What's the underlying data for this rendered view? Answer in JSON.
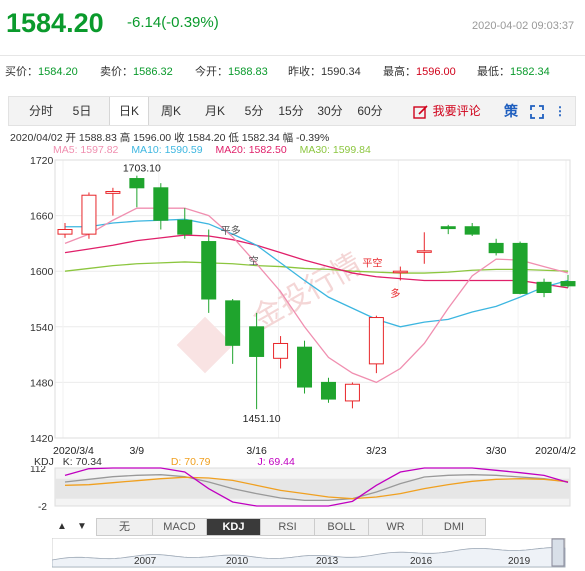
{
  "header": {
    "price": "1584.20",
    "change": "-6.14(-0.39%)",
    "datetime": "2020-04-02 09:03:37"
  },
  "quote": [
    {
      "label": "买价：",
      "value": "1584.20",
      "color": "green"
    },
    {
      "label": "卖价：",
      "value": "1586.32",
      "color": "green"
    },
    {
      "label": "今开：",
      "value": "1588.83",
      "color": "green"
    },
    {
      "label": "昨收：",
      "value": "1590.34",
      "color": "normal"
    },
    {
      "label": "最高：",
      "value": "1596.00",
      "color": "red"
    },
    {
      "label": "最低：",
      "value": "1582.34",
      "color": "green"
    }
  ],
  "tabs": [
    "分时",
    "5日",
    "日K",
    "周K",
    "月K",
    "5分",
    "15分",
    "30分",
    "60分"
  ],
  "selected_tab": "日K",
  "review_label": "我要评论",
  "ce_label": "策",
  "info_line": "2020/04/02  开 1588.83  高 1596.00  收 1584.20  低 1582.34  幅 -0.39%",
  "ma_legend": [
    {
      "label": "MA5: 1597.82",
      "color": "#f08fb0"
    },
    {
      "label": "MA10: 1590.59",
      "color": "#3cb6e0"
    },
    {
      "label": "MA20: 1582.50",
      "color": "#e0206a"
    },
    {
      "label": "MA30: 1599.84",
      "color": "#8cc63f"
    }
  ],
  "annotations": {
    "high": "1703.10",
    "low": "1451.10",
    "ping_duo": "平多",
    "kong": "空",
    "ping_kong": "平空",
    "duo": "多"
  },
  "watermark": "金投行情",
  "kdj": {
    "name": "KDJ",
    "k": "K: 70.34",
    "d": "D: 70.79",
    "j": "J: 69.44",
    "ticks": [
      "112",
      "-2"
    ]
  },
  "indicator_tabs": [
    "无",
    "MACD",
    "KDJ",
    "RSI",
    "BOLL",
    "WR",
    "DMI"
  ],
  "selected_indicator": "KDJ",
  "arrows": [
    "▲",
    "▼"
  ],
  "overview_years": [
    "2007",
    "2010",
    "2013",
    "2016",
    "2019"
  ],
  "chart_data": {
    "type": "candlestick",
    "y_ticks": [
      1720,
      1660,
      1600,
      1540,
      1480,
      1420
    ],
    "ylim": [
      1420,
      1720
    ],
    "x_labels": [
      "2020/3/4",
      "3/9",
      "3/16",
      "3/23",
      "3/30",
      "2020/4/2"
    ],
    "candles": [
      {
        "o": 1640,
        "h": 1652,
        "c": 1645,
        "l": 1636
      },
      {
        "o": 1640,
        "h": 1685,
        "c": 1682,
        "l": 1635
      },
      {
        "o": 1684,
        "h": 1690,
        "c": 1686,
        "l": 1660
      },
      {
        "o": 1700,
        "h": 1703.1,
        "c": 1690,
        "l": 1669
      },
      {
        "o": 1690,
        "h": 1695,
        "c": 1655,
        "l": 1645
      },
      {
        "o": 1655,
        "h": 1668,
        "c": 1640,
        "l": 1635
      },
      {
        "o": 1632,
        "h": 1645,
        "c": 1570,
        "l": 1555
      },
      {
        "o": 1568,
        "h": 1570,
        "c": 1520,
        "l": 1500
      },
      {
        "o": 1540,
        "h": 1555,
        "c": 1508,
        "l": 1451.1
      },
      {
        "o": 1506,
        "h": 1530,
        "c": 1522,
        "l": 1495
      },
      {
        "o": 1518,
        "h": 1525,
        "c": 1475,
        "l": 1468
      },
      {
        "o": 1480,
        "h": 1485,
        "c": 1462,
        "l": 1458
      },
      {
        "o": 1460,
        "h": 1480,
        "c": 1478,
        "l": 1452
      },
      {
        "o": 1500,
        "h": 1552,
        "c": 1550,
        "l": 1490
      },
      {
        "o": 1600,
        "h": 1605,
        "c": 1600,
        "l": 1590
      },
      {
        "o": 1622,
        "h": 1642,
        "c": 1622,
        "l": 1608
      },
      {
        "o": 1648,
        "h": 1650,
        "c": 1646,
        "l": 1640
      },
      {
        "o": 1648,
        "h": 1652,
        "c": 1640,
        "l": 1638
      },
      {
        "o": 1630,
        "h": 1635,
        "c": 1620,
        "l": 1617
      },
      {
        "o": 1630,
        "h": 1632,
        "c": 1576,
        "l": 1575
      },
      {
        "o": 1588,
        "h": 1592,
        "c": 1577,
        "l": 1572
      },
      {
        "o": 1588.83,
        "h": 1596,
        "c": 1584.2,
        "l": 1582.34
      }
    ],
    "ma5": [
      1630,
      1640,
      1655,
      1668,
      1668,
      1668,
      1660,
      1637,
      1608,
      1578,
      1540,
      1507,
      1490,
      1480,
      1495,
      1522,
      1560,
      1595,
      1613,
      1612,
      1605,
      1598
    ],
    "ma10": [
      1648,
      1648,
      1652,
      1654,
      1655,
      1656,
      1651,
      1640,
      1628,
      1609,
      1590,
      1572,
      1560,
      1548,
      1540,
      1545,
      1548,
      1556,
      1562,
      1572,
      1583,
      1590
    ],
    "ma20": [
      1620,
      1624,
      1628,
      1633,
      1636,
      1639,
      1638,
      1634,
      1628,
      1620,
      1612,
      1605,
      1598,
      1594,
      1592,
      1590,
      1590,
      1590,
      1590,
      1590,
      1586,
      1582
    ],
    "ma30": [
      1600,
      1603,
      1606,
      1608,
      1609,
      1610,
      1609,
      1608,
      1606,
      1605,
      1603,
      1602,
      1600,
      1599,
      1598,
      1598,
      1599,
      1601,
      1602,
      1602,
      1601,
      1600
    ],
    "kdj_k": [
      70,
      78,
      86,
      90,
      92,
      86,
      70,
      50,
      35,
      22,
      15,
      15,
      20,
      40,
      65,
      85,
      90,
      92,
      90,
      85,
      80,
      70
    ],
    "kdj_d": [
      60,
      62,
      68,
      74,
      80,
      84,
      82,
      75,
      60,
      45,
      35,
      25,
      20,
      25,
      35,
      50,
      62,
      72,
      78,
      80,
      78,
      71
    ],
    "kdj_j": [
      90,
      110,
      112,
      112,
      112,
      100,
      50,
      10,
      -2,
      -2,
      -2,
      -2,
      12,
      60,
      100,
      112,
      112,
      112,
      105,
      98,
      90,
      69
    ]
  }
}
